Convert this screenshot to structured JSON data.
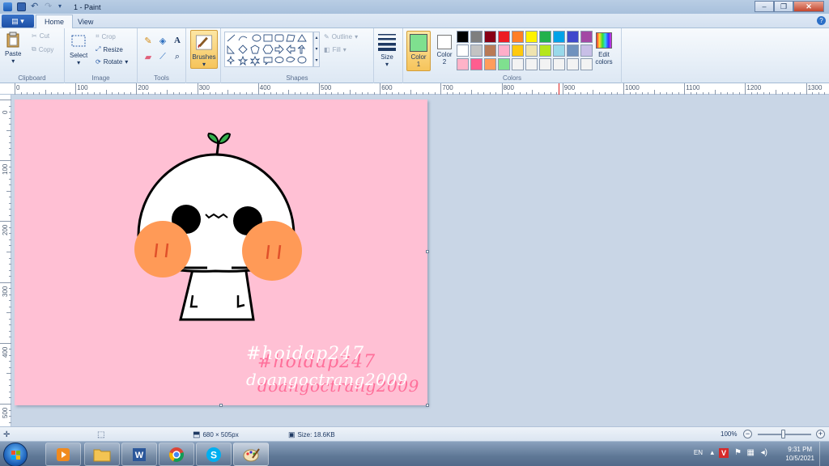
{
  "window": {
    "title": "1 - Paint"
  },
  "tabs": [
    {
      "label": "Home",
      "active": true
    },
    {
      "label": "View",
      "active": false
    }
  ],
  "ribbon": {
    "clipboard": {
      "label": "Clipboard",
      "paste": "Paste",
      "cut": "Cut",
      "copy": "Copy"
    },
    "image": {
      "label": "Image",
      "select": "Select",
      "crop": "Crop",
      "resize": "Resize",
      "rotate": "Rotate"
    },
    "tools": {
      "label": "Tools",
      "text_glyph": "A"
    },
    "brushes": "Brushes",
    "shapes": {
      "label": "Shapes",
      "outline": "Outline",
      "fill": "Fill"
    },
    "size": "Size",
    "colors": {
      "label": "Colors",
      "color1": "Color",
      "color1_num": "1",
      "color2": "Color",
      "color2_num": "2",
      "edit_colors_1": "Edit",
      "edit_colors_2": "colors",
      "color1_value": "#7fe08f",
      "color2_value": "#ffffff",
      "palette": [
        "#000000",
        "#7f7f7f",
        "#880015",
        "#ed1c24",
        "#ff7f27",
        "#fff200",
        "#22b14c",
        "#00a2e8",
        "#3f48cc",
        "#a349a4",
        "#ffffff",
        "#c3c3c3",
        "#b97a57",
        "#ffaec9",
        "#ffc90e",
        "#efe4b0",
        "#b5e61d",
        "#99d9ea",
        "#7092be",
        "#c8bfe7",
        "#ffb3c8",
        "#ff5d8f",
        "#ff9d5c",
        "#7fe08f",
        "#f3f3f3",
        "#f3f3f3",
        "#f3f3f3",
        "#f3f3f3",
        "#f3f3f3",
        "#f3f3f3"
      ]
    }
  },
  "ruler": {
    "h_labels": [
      "0",
      "100",
      "200",
      "300",
      "400",
      "500",
      "600",
      "700",
      "800",
      "900",
      "1000",
      "1100",
      "1200",
      "1300"
    ],
    "v_labels": [
      "0",
      "100",
      "200",
      "300",
      "400",
      "500"
    ]
  },
  "canvas": {
    "background": "#ffc0d4",
    "text_line_1": "#hoidap247",
    "text_line_2": "doangoctrang2009"
  },
  "status": {
    "dimensions": "680 × 505px",
    "size": "Size: 18.6KB",
    "zoom": "100%"
  },
  "taskbar": {
    "language": "EN",
    "time": "9:31 PM",
    "date": "10/5/2021"
  }
}
